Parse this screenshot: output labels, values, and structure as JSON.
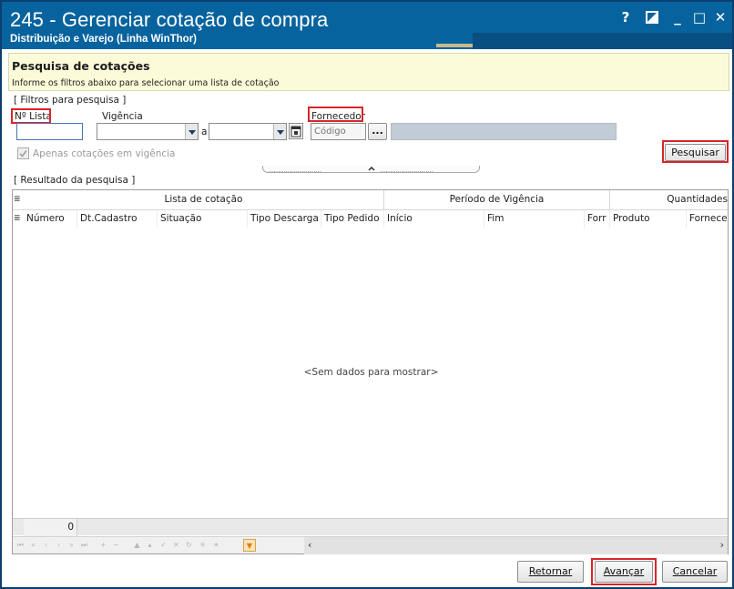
{
  "window": {
    "title": "245 - Gerenciar cotação de compra",
    "subtitle": "Distribuição e Varejo (Linha WinThor)",
    "controls": {
      "help": "?",
      "minimize": "_",
      "maximize": "□",
      "close": "✕"
    }
  },
  "header": {
    "title": "Pesquisa de cotações",
    "instructions": "Informe os filtros abaixo para selecionar uma lista de cotação"
  },
  "filters": {
    "group_label": "[ Filtros para pesquisa ]",
    "numero_lista_label": "Nº Lista",
    "numero_lista_value": "",
    "vigencia_label": "Vigência",
    "vigencia_from": "",
    "vigencia_separator": "a",
    "vigencia_to": "",
    "fornecedor_label": "Fornecedor",
    "fornecedor_code_placeholder": "Código",
    "fornecedor_lookup_label": "...",
    "fornecedor_name": "",
    "apenas_vigencia_label": "Apenas cotações em vigência",
    "apenas_vigencia_checked": true,
    "search_button": "Pesquisar"
  },
  "results": {
    "group_label": "[ Resultado da pesquisa ]",
    "bands": [
      "Lista de cotação",
      "Período de Vigência",
      "Quantidades"
    ],
    "columns": [
      "Número",
      "Dt.Cadastro",
      "Situação",
      "Tipo Descarga",
      "Tipo Pedido",
      "Início",
      "Fim",
      "Forr",
      "Produto",
      "Fornece"
    ],
    "empty_message": "<Sem dados para mostrar>",
    "footer_count": "0"
  },
  "buttons": {
    "retornar": "Retornar",
    "avancar": "Avançar",
    "cancelar": "Cancelar"
  },
  "colors": {
    "titlebar": "#06639e",
    "header_bg": "#fcfbd9",
    "highlight": "#d9252a"
  }
}
